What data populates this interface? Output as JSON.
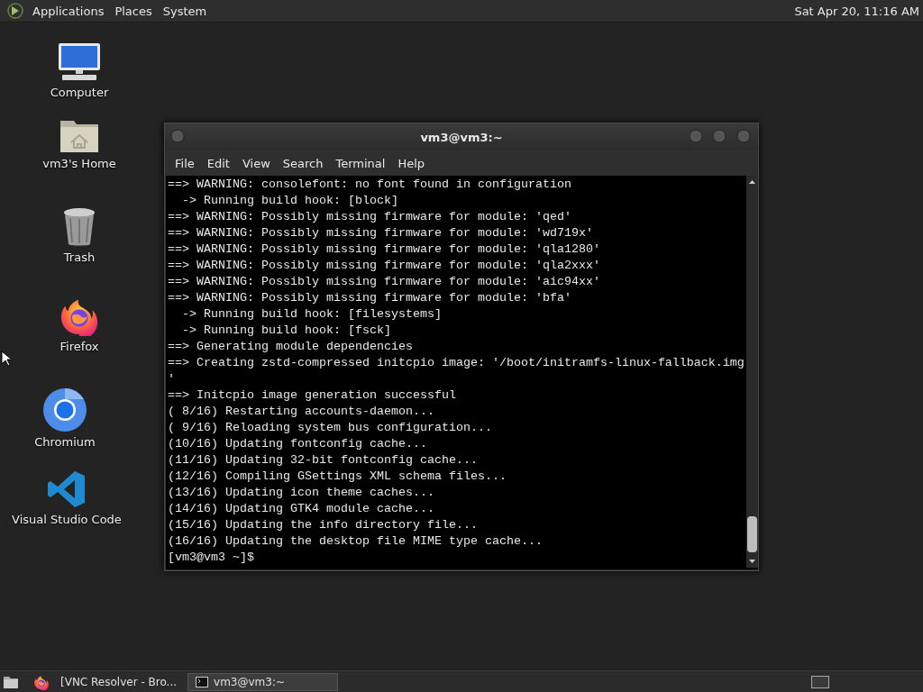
{
  "top_panel": {
    "menus": [
      "Applications",
      "Places",
      "System"
    ],
    "clock": "Sat Apr 20, 11:16 AM"
  },
  "desktop_icons": [
    {
      "kind": "computer",
      "label": "Computer"
    },
    {
      "kind": "home",
      "label": "vm3's Home"
    },
    {
      "kind": "trash",
      "label": "Trash"
    },
    {
      "kind": "firefox",
      "label": "Firefox"
    },
    {
      "kind": "chromium",
      "label": "Chromium"
    },
    {
      "kind": "vscode",
      "label": "Visual Studio Code"
    }
  ],
  "window": {
    "title": "vm3@vm3:~",
    "menu": [
      "File",
      "Edit",
      "View",
      "Search",
      "Terminal",
      "Help"
    ],
    "lines": [
      "==> WARNING: consolefont: no font found in configuration",
      "  -> Running build hook: [block]",
      "==> WARNING: Possibly missing firmware for module: 'qed'",
      "==> WARNING: Possibly missing firmware for module: 'wd719x'",
      "==> WARNING: Possibly missing firmware for module: 'qla1280'",
      "==> WARNING: Possibly missing firmware for module: 'qla2xxx'",
      "==> WARNING: Possibly missing firmware for module: 'aic94xx'",
      "==> WARNING: Possibly missing firmware for module: 'bfa'",
      "  -> Running build hook: [filesystems]",
      "  -> Running build hook: [fsck]",
      "==> Generating module dependencies",
      "==> Creating zstd-compressed initcpio image: '/boot/initramfs-linux-fallback.img",
      "'",
      "==> Initcpio image generation successful",
      "( 8/16) Restarting accounts-daemon...",
      "( 9/16) Reloading system bus configuration...",
      "(10/16) Updating fontconfig cache...",
      "(11/16) Updating 32-bit fontconfig cache...",
      "(12/16) Compiling GSettings XML schema files...",
      "(13/16) Updating icon theme caches...",
      "(14/16) Updating GTK4 module cache...",
      "(15/16) Updating the info directory file...",
      "(16/16) Updating the desktop file MIME type cache...",
      "[vm3@vm3 ~]$"
    ]
  },
  "taskbar": {
    "tasks": [
      {
        "kind": "browser",
        "label": "[VNC Resolver - Bro...",
        "selected": false
      },
      {
        "kind": "terminal",
        "label": "vm3@vm3:~",
        "selected": true
      }
    ]
  }
}
